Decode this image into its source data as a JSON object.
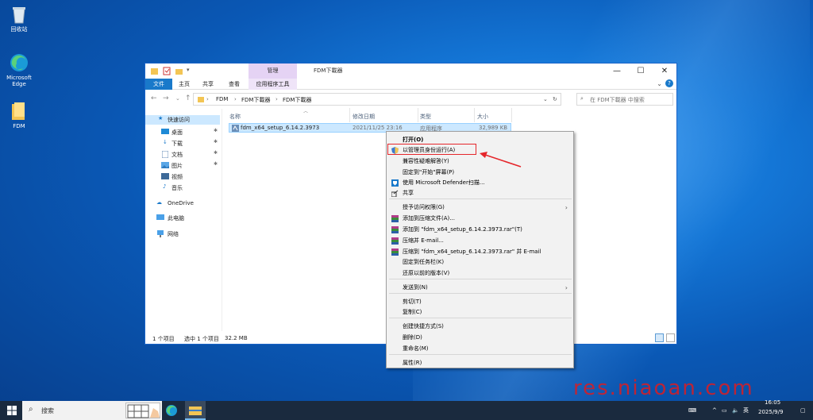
{
  "desktop": {
    "icons": [
      {
        "label": "回收站"
      },
      {
        "label": "Microsoft Edge"
      },
      {
        "label": "FDM"
      }
    ]
  },
  "window": {
    "title": "FDM下載器",
    "context_tab_header": "管理",
    "ribbon_tabs": [
      "文件",
      "主页",
      "共享",
      "查看",
      "应用程序工具"
    ],
    "address_crumbs": [
      "FDM",
      "FDM下載器",
      "FDM下載器"
    ],
    "search_placeholder": "在 FDM下載器 中搜索",
    "nav": {
      "quick_access": "快速访问",
      "items": [
        "桌面",
        "下载",
        "文档",
        "图片",
        "视频",
        "音乐"
      ],
      "onedrive": "OneDrive",
      "this_pc": "此电脑",
      "network": "网络"
    },
    "columns": [
      "名称",
      "修改日期",
      "类型",
      "大小"
    ],
    "file": {
      "name": "fdm_x64_setup_6.14.2.3973",
      "date": "2021/11/25 23:16",
      "type": "应用程序",
      "size": "32,989 KB"
    },
    "status": {
      "count": "1 个项目",
      "selected": "选中 1 个项目",
      "size": "32.2 MB"
    }
  },
  "context_menu": {
    "items": [
      {
        "label": "打开(O)",
        "bold": true
      },
      {
        "label": "以管理员身份运行(A)",
        "icon": "uac-shield-icon"
      },
      {
        "label": "兼容性疑难解答(Y)"
      },
      {
        "label": "固定到\"开始\"屏幕(P)"
      },
      {
        "label": "使用 Microsoft Defender扫描...",
        "icon": "defender-icon"
      },
      {
        "label": "共享",
        "icon": "share-icon"
      },
      {
        "label": "授予访问权限(G)",
        "submenu": true
      },
      {
        "label": "添加到压缩文件(A)...",
        "icon": "winrar-icon"
      },
      {
        "label": "添加到 \"fdm_x64_setup_6.14.2.3973.rar\"(T)",
        "icon": "winrar-icon"
      },
      {
        "label": "压缩并 E-mail...",
        "icon": "winrar-icon"
      },
      {
        "label": "压缩到 \"fdm_x64_setup_6.14.2.3973.rar\" 并 E-mail",
        "icon": "winrar-icon"
      },
      {
        "label": "固定到任务栏(K)"
      },
      {
        "label": "还原以前的版本(V)"
      },
      {
        "label": "发送到(N)",
        "submenu": true
      },
      {
        "label": "剪切(T)"
      },
      {
        "label": "复制(C)"
      },
      {
        "label": "创建快捷方式(S)"
      },
      {
        "label": "删除(D)"
      },
      {
        "label": "重命名(M)"
      },
      {
        "label": "属性(R)"
      }
    ]
  },
  "taskbar": {
    "search_label": "搜索",
    "ime": "英",
    "time": "16:05",
    "date": "2025/9/9"
  },
  "watermark": "res.niaoan.com",
  "colors": {
    "accent": "#1979ca",
    "selection": "#cce8ff",
    "highlight_box": "#e5262b",
    "context_tab": "#e5d3f4"
  }
}
